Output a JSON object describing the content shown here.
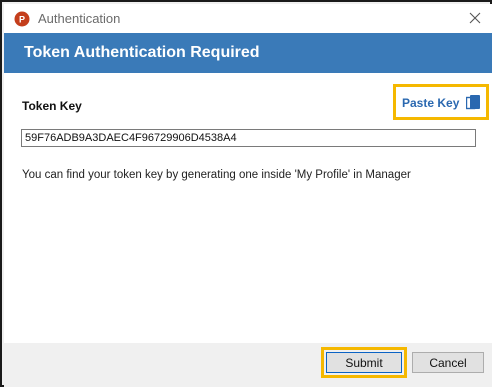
{
  "window": {
    "title": "Authentication",
    "app_icon": "powerpoint-icon",
    "close_icon": "close-icon"
  },
  "header": {
    "title": "Token Authentication Required"
  },
  "form": {
    "token_label": "Token Key",
    "paste_label": "Paste Key",
    "paste_icon": "clipboard-icon",
    "token_value": "59F76ADB9A3DAEC4F96729906D4538A4",
    "help_text": "You can find your token key by generating one inside 'My Profile' in Manager"
  },
  "footer": {
    "submit_label": "Submit",
    "cancel_label": "Cancel"
  },
  "colors": {
    "header_band": "#3a7ab8",
    "highlight": "#f5b800",
    "link": "#2a68b0",
    "app_icon": "#c43e1c"
  }
}
